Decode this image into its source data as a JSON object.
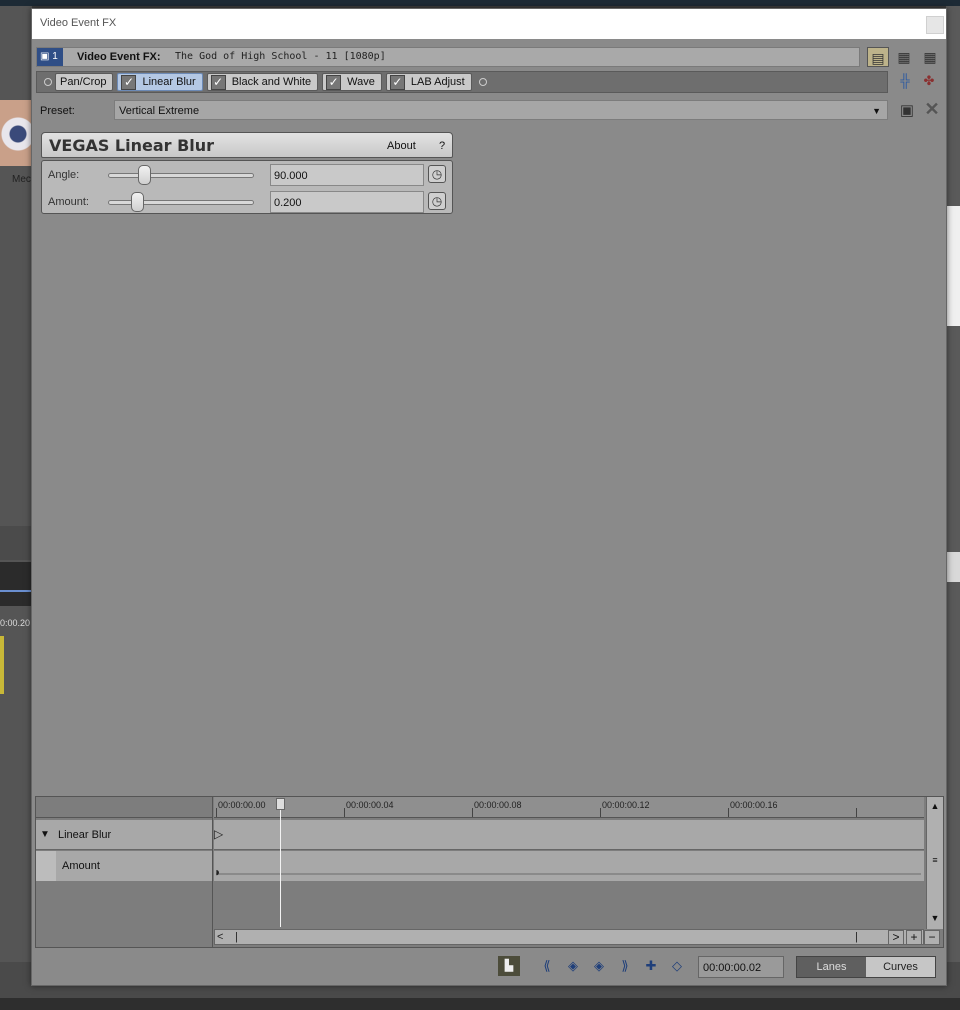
{
  "background_app": {
    "left_label": "Mec",
    "left_time": "0:00.20"
  },
  "dialog": {
    "title": "Video Event FX",
    "header": {
      "track_number": "1",
      "label": "Video Event FX:",
      "event_name": "The God of High School - 11 [1080p]"
    },
    "fx_chain": [
      {
        "label": "Pan/Crop",
        "checked": false,
        "active": false
      },
      {
        "label": "Linear Blur",
        "checked": true,
        "active": true
      },
      {
        "label": "Black and White",
        "checked": true,
        "active": false
      },
      {
        "label": "Wave",
        "checked": true,
        "active": false
      },
      {
        "label": "LAB Adjust",
        "checked": true,
        "active": false
      }
    ],
    "preset": {
      "label": "Preset:",
      "value": "Vertical Extreme"
    },
    "plugin": {
      "title": "VEGAS Linear Blur",
      "about_label": "About",
      "help_label": "?",
      "params": [
        {
          "label": "Angle:",
          "value": "90.000",
          "slider_fraction": 0.25
        },
        {
          "label": "Amount:",
          "value": "0.200",
          "slider_fraction": 0.2
        }
      ]
    },
    "keyframes": {
      "ruler_ticks": [
        "00:00:00.00",
        "00:00:00.04",
        "00:00:00.08",
        "00:00:00.12",
        "00:00:00.16"
      ],
      "tracks": [
        {
          "label": "Linear Blur"
        },
        {
          "label": "Amount"
        }
      ]
    },
    "bottom": {
      "time": "00:00:00.02",
      "lanes_label": "Lanes",
      "curves_label": "Curves"
    }
  }
}
